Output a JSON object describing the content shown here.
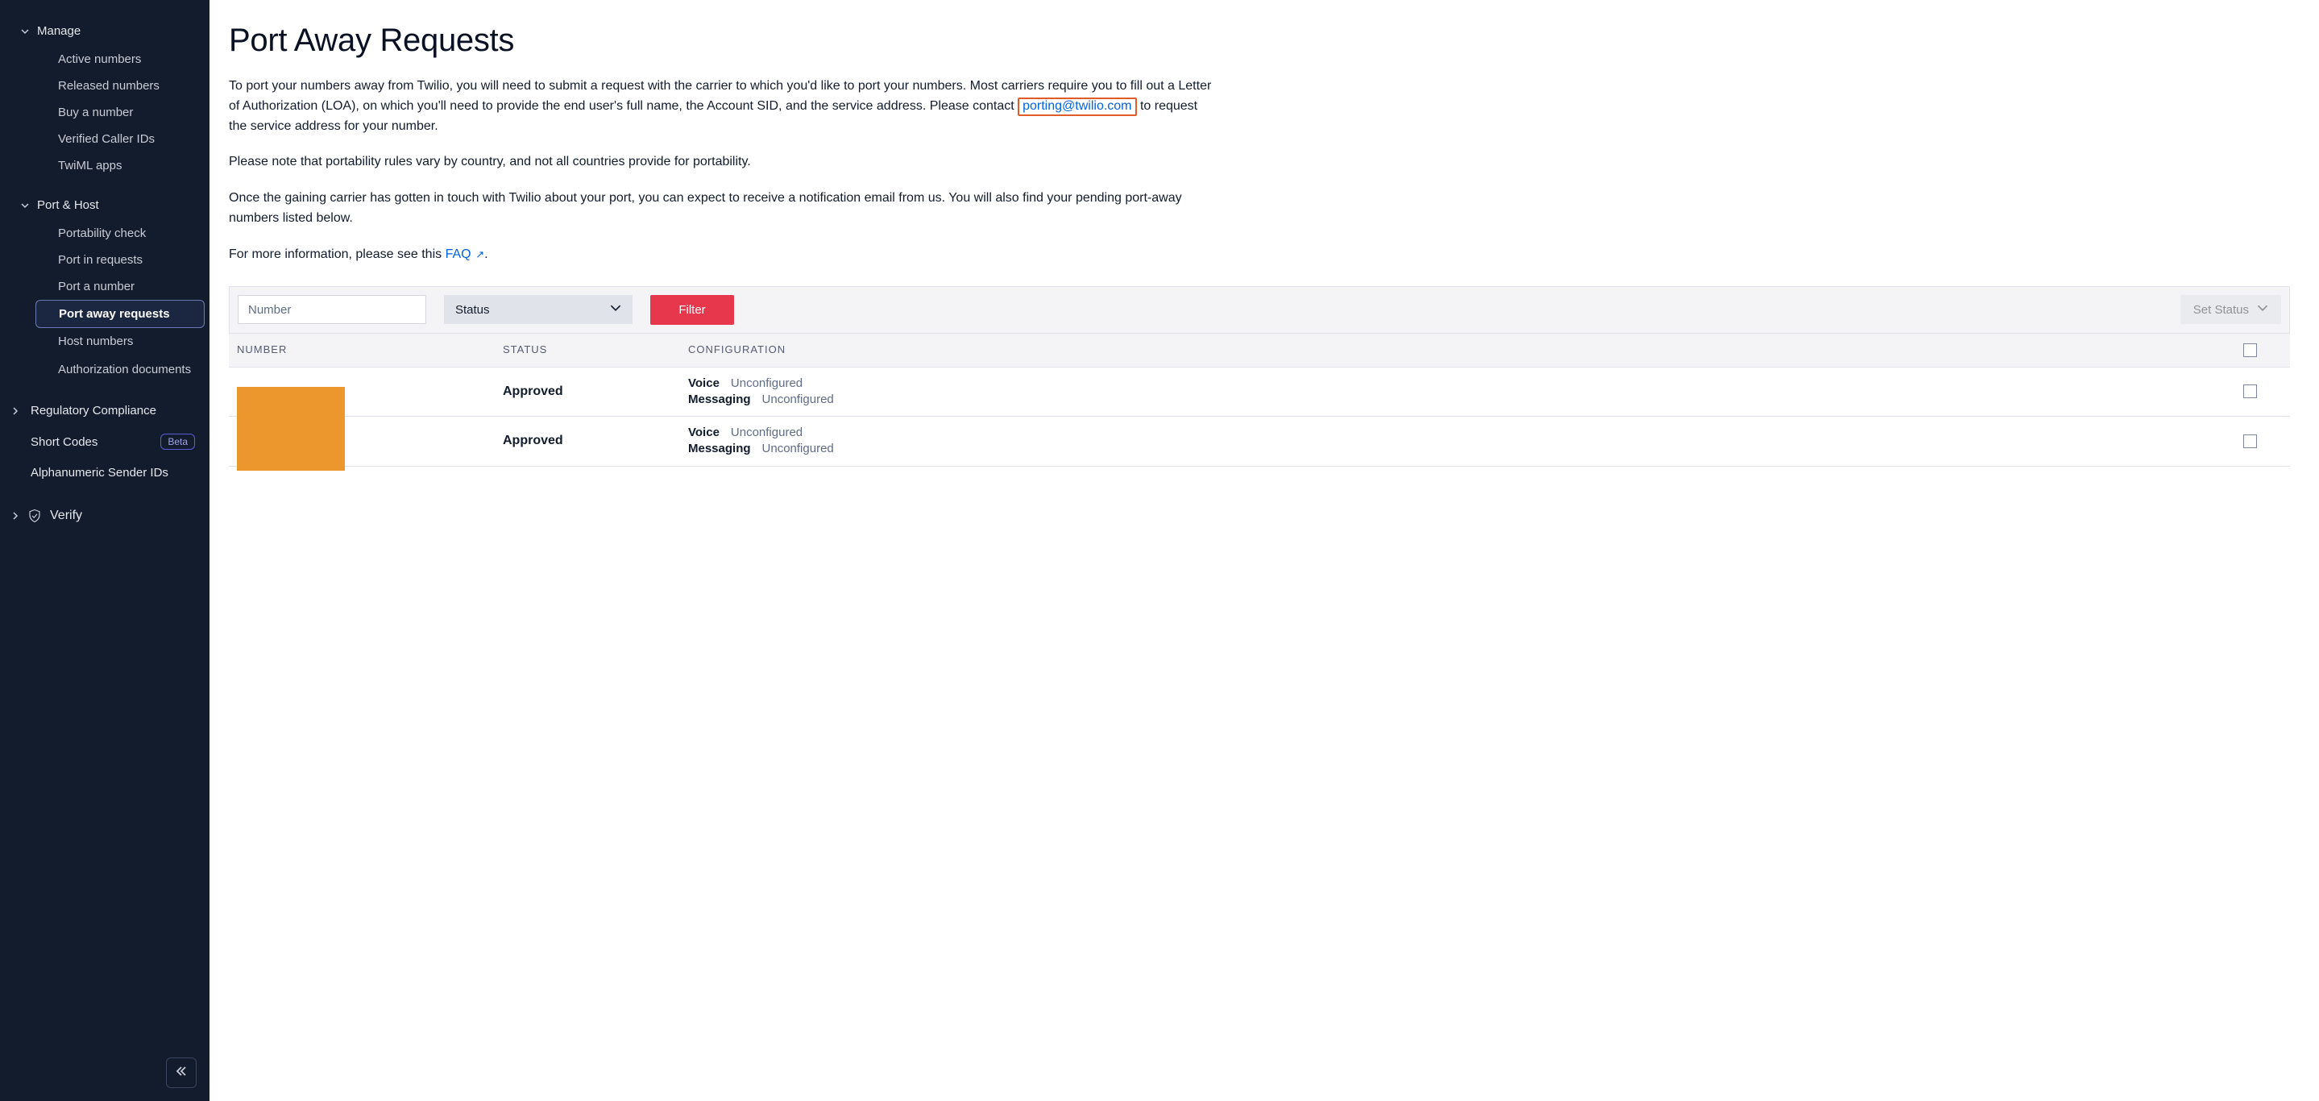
{
  "sidebar": {
    "manage": {
      "label": "Manage",
      "items": [
        {
          "label": "Active numbers"
        },
        {
          "label": "Released numbers"
        },
        {
          "label": "Buy a number"
        },
        {
          "label": "Verified Caller IDs"
        },
        {
          "label": "TwiML apps"
        }
      ]
    },
    "port_host": {
      "label": "Port & Host",
      "items": [
        {
          "label": "Portability check"
        },
        {
          "label": "Port in requests"
        },
        {
          "label": "Port a number"
        },
        {
          "label": "Port away requests",
          "active": true
        },
        {
          "label": "Host numbers"
        },
        {
          "label": "Authorization documents"
        }
      ]
    },
    "regulatory": {
      "label": "Regulatory Compliance"
    },
    "short_codes": {
      "label": "Short Codes",
      "badge": "Beta"
    },
    "alpha_sender": {
      "label": "Alphanumeric Sender IDs"
    },
    "verify": {
      "label": "Verify"
    }
  },
  "page": {
    "title": "Port Away Requests",
    "p1_a": "To port your numbers away from Twilio, you will need to submit a request with the carrier to which you'd like to port your numbers. Most carriers require you to fill out a Letter of Authorization (LOA), on which you'll need to provide the end user's full name, the Account SID, and the service address. Please contact ",
    "p1_link": "porting@twilio.com",
    "p1_b": " to request the service address for your number.",
    "p2": "Please note that portability rules vary by country, and not all countries provide for portability.",
    "p3": "Once the gaining carrier has gotten in touch with Twilio about your port, you can expect to receive a notification email from us. You will also find your pending port-away numbers listed below.",
    "p4_a": "For more information, please see this ",
    "p4_link": "FAQ"
  },
  "filter": {
    "number_placeholder": "Number",
    "status_label": "Status",
    "filter_btn": "Filter",
    "set_status": "Set Status"
  },
  "table": {
    "headers": {
      "number": "NUMBER",
      "status": "STATUS",
      "config": "CONFIGURATION"
    },
    "voice_label": "Voice",
    "messaging_label": "Messaging",
    "unconfigured": "Unconfigured",
    "rows": [
      {
        "status": "Approved"
      },
      {
        "status": "Approved"
      }
    ]
  }
}
